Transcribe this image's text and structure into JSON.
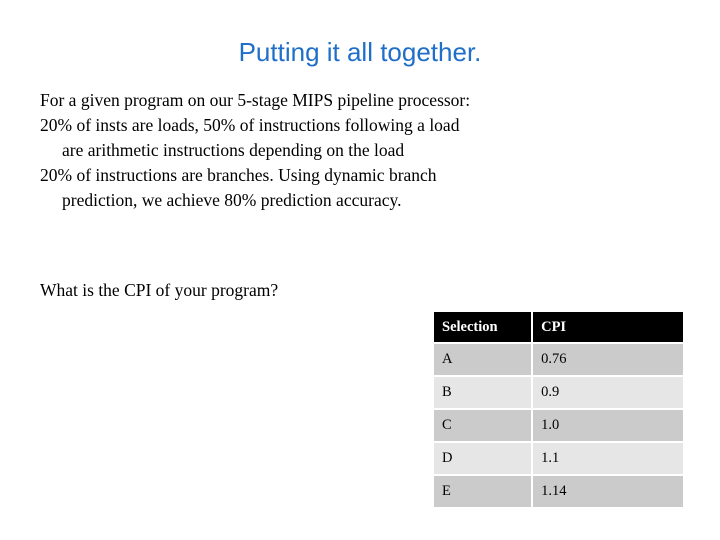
{
  "slide": {
    "title": "Putting it all together.",
    "title_color": "#1F6FC8",
    "background_color": "#FFFFFF",
    "body_lines": [
      {
        "text": "For a given program on our 5-stage MIPS pipeline processor:",
        "indent": false
      },
      {
        "text": "20% of insts are loads, 50% of instructions following a load",
        "indent": false
      },
      {
        "text": "are arithmetic instructions depending on the load",
        "indent": true
      },
      {
        "text": "20% of instructions are branches.  Using dynamic branch",
        "indent": false
      },
      {
        "text": "prediction, we achieve 80% prediction accuracy.",
        "indent": true
      }
    ],
    "question": "What is the CPI of your program?"
  },
  "table": {
    "header_background": "#000000",
    "header_text_color": "#FFFFFF",
    "row_dark_color": "#CBCBCB",
    "row_light_color": "#E6E6E6",
    "columns": [
      "Selection",
      "CPI"
    ],
    "rows": [
      {
        "selection": "A",
        "cpi": "0.76"
      },
      {
        "selection": "B",
        "cpi": "0.9"
      },
      {
        "selection": "C",
        "cpi": "1.0"
      },
      {
        "selection": "D",
        "cpi": "1.1"
      },
      {
        "selection": "E",
        "cpi": "1.14"
      }
    ]
  }
}
